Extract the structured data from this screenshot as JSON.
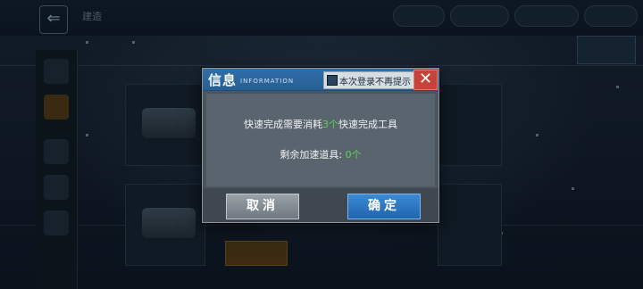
{
  "dialog": {
    "title": "信息",
    "subtitle": "INFORMATION",
    "dont_show_again_label": "本次登录不再提示",
    "close_glyph": "✕",
    "message1": {
      "prefix": "快速完成需要消耗",
      "count": "3个",
      "suffix": "快速完成工具"
    },
    "message2": {
      "prefix": "剩余加速道具: ",
      "count": "0个"
    },
    "cancel_label": "取消",
    "confirm_label": "确定"
  },
  "background": {
    "back_glyph": "⇐",
    "top_title": "建造"
  },
  "colors": {
    "header_blue": "#2f6ea8",
    "highlight_green": "#59d34f",
    "close_red": "#c8423a",
    "confirm_blue": "#1f64ae"
  }
}
